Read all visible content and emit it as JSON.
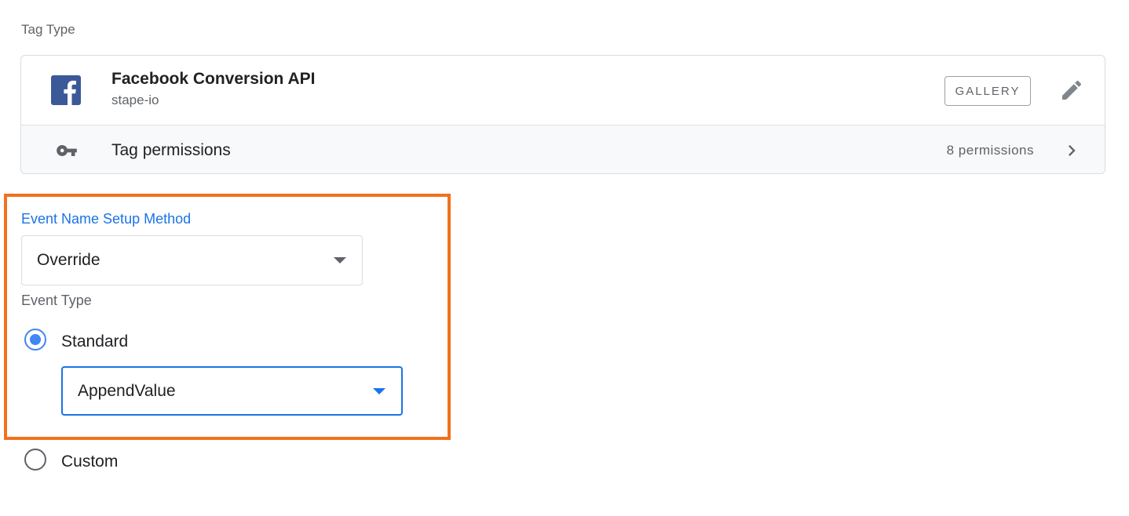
{
  "section": {
    "label": "Tag Type"
  },
  "tag": {
    "name": "Facebook Conversion API",
    "author": "stape-io",
    "gallery_label": "GALLERY",
    "icons": {
      "logo": "facebook-logo-icon",
      "edit": "pencil-icon"
    }
  },
  "permissions": {
    "label": "Tag permissions",
    "count": "8 permissions",
    "icons": {
      "key": "key-icon",
      "chevron": "chevron-right-icon"
    }
  },
  "event_name_setup": {
    "label": "Event Name Setup Method",
    "selected": "Override"
  },
  "event_type": {
    "label": "Event Type",
    "options": [
      {
        "label": "Standard",
        "checked": true
      },
      {
        "label": "Custom",
        "checked": false
      }
    ],
    "standard_selected": "AppendValue"
  },
  "colors": {
    "accent": "#1a73e8",
    "highlight_border": "#f2711c",
    "facebook_brand": "#3b5998"
  }
}
